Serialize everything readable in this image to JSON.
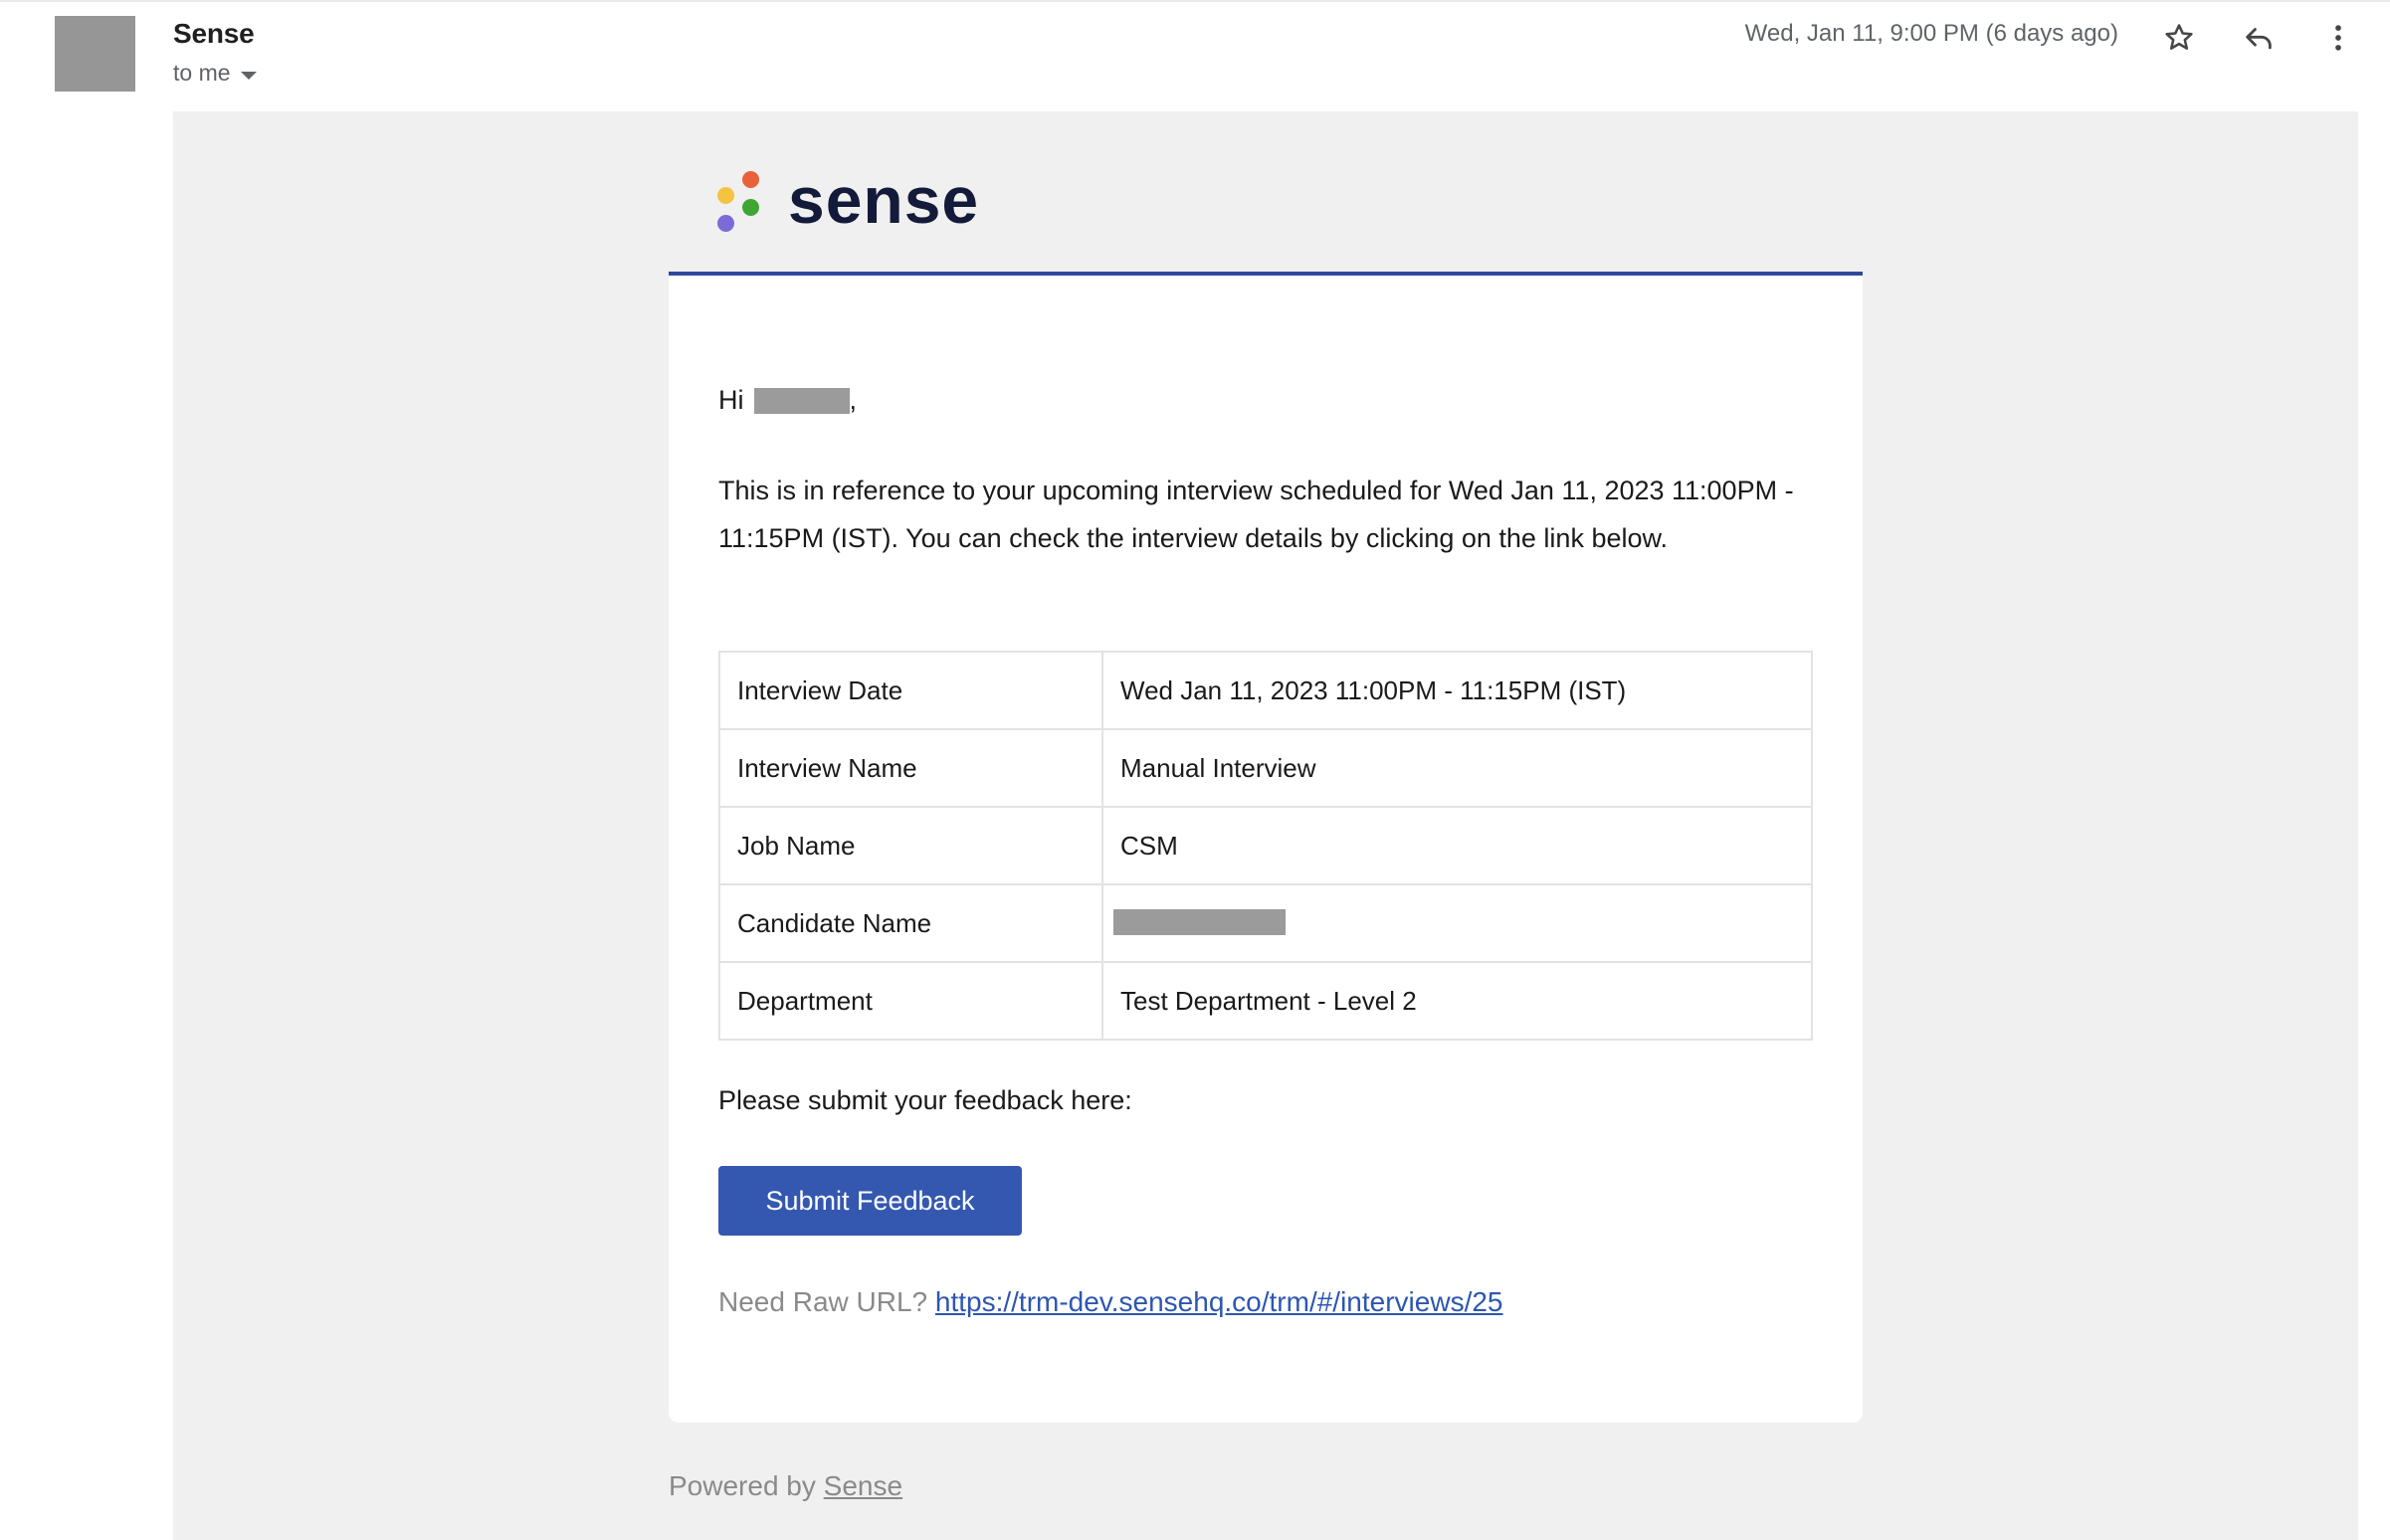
{
  "header": {
    "sender": "Sense",
    "recipient": "to me",
    "timestamp": "Wed, Jan 11, 9:00 PM (6 days ago)",
    "icons": {
      "star": "star-icon",
      "reply": "reply-icon",
      "more": "more-vert-icon"
    }
  },
  "logo": {
    "text": "sense",
    "dot_colors": [
      "#e8613a",
      "#f5c342",
      "#3fa535",
      "#7b6bd9"
    ]
  },
  "body": {
    "greeting_prefix": "Hi",
    "greeting_suffix": ",",
    "intro": "This is in reference to your upcoming interview scheduled for Wed Jan 11, 2023 11:00PM - 11:15PM (IST). You can check the interview details by clicking on the link below.",
    "details": [
      {
        "label": "Interview Date",
        "value": "Wed Jan 11, 2023 11:00PM - 11:15PM (IST)"
      },
      {
        "label": "Interview Name",
        "value": "Manual Interview"
      },
      {
        "label": "Job Name",
        "value": "CSM"
      },
      {
        "label": "Candidate Name",
        "value": ""
      },
      {
        "label": "Department",
        "value": "Test Department - Level 2"
      }
    ],
    "feedback_prompt": "Please submit your feedback here:",
    "submit_label": "Submit Feedback",
    "raw_url_prefix": "Need Raw URL?",
    "raw_url": "https://trm-dev.sensehq.co/trm/#/interviews/25"
  },
  "footer": {
    "powered_by": "Powered by",
    "brand_link": "Sense"
  },
  "colors": {
    "accent": "#2f4a9c",
    "button": "#3458b0",
    "link": "#2d56b0",
    "redaction": "#9b9b9b"
  }
}
